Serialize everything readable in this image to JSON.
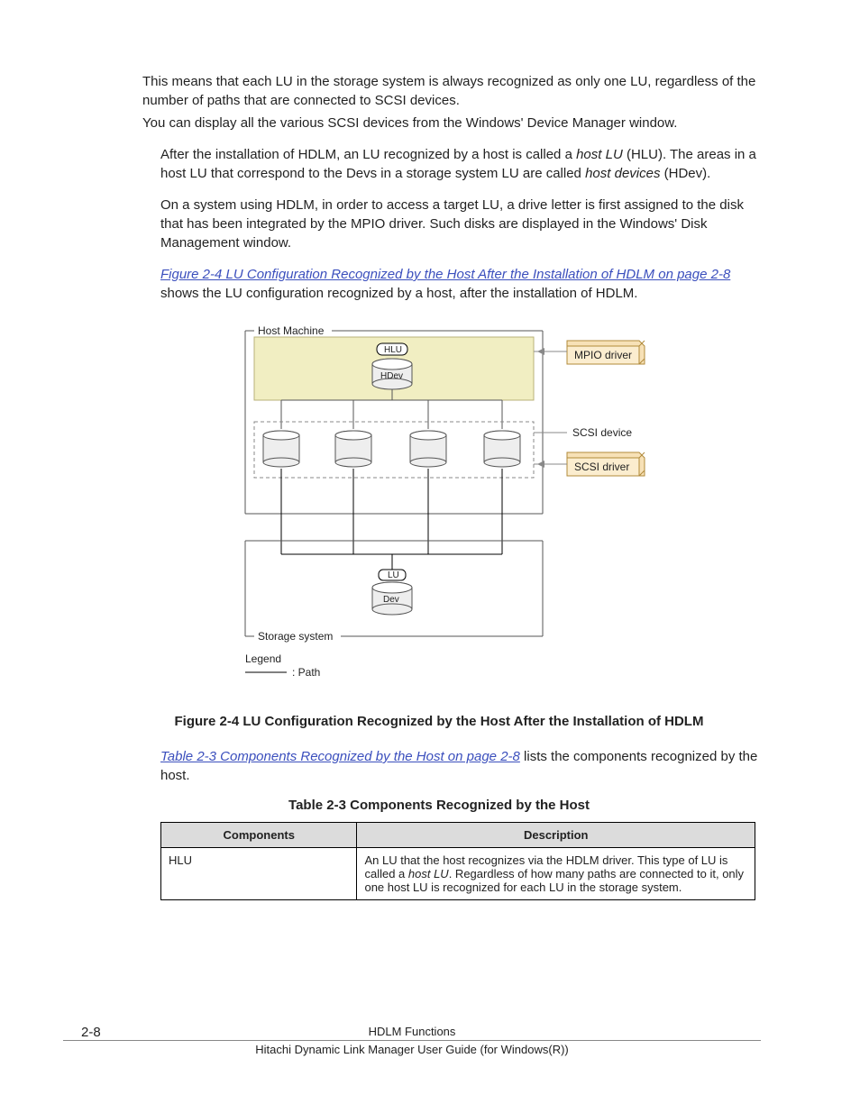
{
  "body": {
    "p1": "This means that each LU in the storage system is always recognized as only one LU, regardless of the number of paths that are connected to SCSI devices.",
    "p2": "You can display all the various SCSI devices from the Windows' Device Manager window.",
    "p3a": "After the installation of HDLM, an LU recognized by a host is called a ",
    "p3_em1": "host LU",
    "p3b": " (HLU). The areas in a host LU that correspond to the Devs in a storage system LU are called ",
    "p3_em2": "host devices",
    "p3c": " (HDev).",
    "p4": "On a system using HDLM, in order to access a target LU, a drive letter is first assigned to the disk that has been integrated by the MPIO driver. Such disks are displayed in the Windows' Disk Management window.",
    "p5_link": "Figure 2-4 LU Configuration Recognized by the Host After the Installation of HDLM on page 2-8",
    "p5_tail": " shows the LU configuration recognized by a host, after the installation of HDLM.",
    "p6_link": "Table 2-3 Components Recognized by the Host on page 2-8",
    "p6_tail": " lists the components recognized by the host."
  },
  "diagram": {
    "host_machine": "Host Machine",
    "hlu": "HLU",
    "hdev": "HDev",
    "mpio": "MPIO driver",
    "scsi_device": "SCSI device",
    "scsi_driver": "SCSI driver",
    "lu": "LU",
    "dev": "Dev",
    "storage_system": "Storage system",
    "legend_title": "Legend",
    "legend_path": ": Path"
  },
  "captions": {
    "fig": "Figure 2-4 LU Configuration Recognized by the Host After the Installation of HDLM",
    "tbl": "Table 2-3 Components Recognized by the Host"
  },
  "table": {
    "h1": "Components",
    "h2": "Description",
    "r1c1": "HLU",
    "r1c2a": "An LU that the host recognizes via the HDLM driver. This type of LU is called a ",
    "r1c2_em": "host LU",
    "r1c2b": ". Regardless of how many paths are connected to it, only one host LU is recognized for each LU in the storage system."
  },
  "footer": {
    "pnum": "2-8",
    "line1": "HDLM Functions",
    "line2": "Hitachi Dynamic Link Manager User Guide (for Windows(R))"
  }
}
